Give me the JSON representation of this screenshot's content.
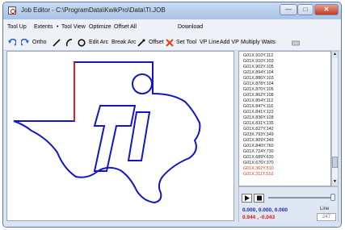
{
  "window": {
    "title": "Job Editor - C:\\ProgramData\\KwikPro\\Data\\TI.JOB",
    "controls": {
      "minimize": "—",
      "maximize": "□",
      "close": "✕"
    }
  },
  "menu": {
    "tool_up": "Tool Up",
    "extents": "Extents",
    "tool_view": "Tool View",
    "optimize": "Optimize",
    "offset_all": "Offset All",
    "download": "Download"
  },
  "toolbar": {
    "ortho": "Ortho",
    "edit_arc": "Edit Arc",
    "break_arc": "Break Arc",
    "offset": "Offset",
    "set_tool": "Set Tool",
    "vp_line": "VP Line",
    "add_vp": "Add VP",
    "multiply_waits": "Multiply Waits"
  },
  "gcode_lines": [
    "G01X.910Y.112",
    "G01X.910Y.103",
    "G01X.902Y.105",
    "G01X.894Y.104",
    "G01X.886Y.103",
    "G01X.878Y.104",
    "G01X.870Y.105",
    "G01X.862Y.108",
    "G01X.854Y.112",
    "G01X.847Y.116",
    "G01X.841Y.122",
    "G01X.836Y.128",
    "G01X.831Y.135",
    "G01X.827Y.142",
    "G03X.793Y.349",
    "G01X.809Y.349",
    "G01X.840Y.760",
    "G01X.724Y.730",
    "G01X.689Y.630",
    "G01X.676Y.370",
    "G01X.362Y.510",
    "G01X.311Y.510"
  ],
  "position": {
    "xyz": "0.000, 0.000, 0.000",
    "offset": "0.944 , -0.043"
  },
  "line": {
    "label": "Line",
    "value": "247"
  },
  "colors": {
    "shape": "#1414c8",
    "tool_path": "#e02020",
    "coords": "#1a1acc",
    "offset": "#d81818"
  }
}
